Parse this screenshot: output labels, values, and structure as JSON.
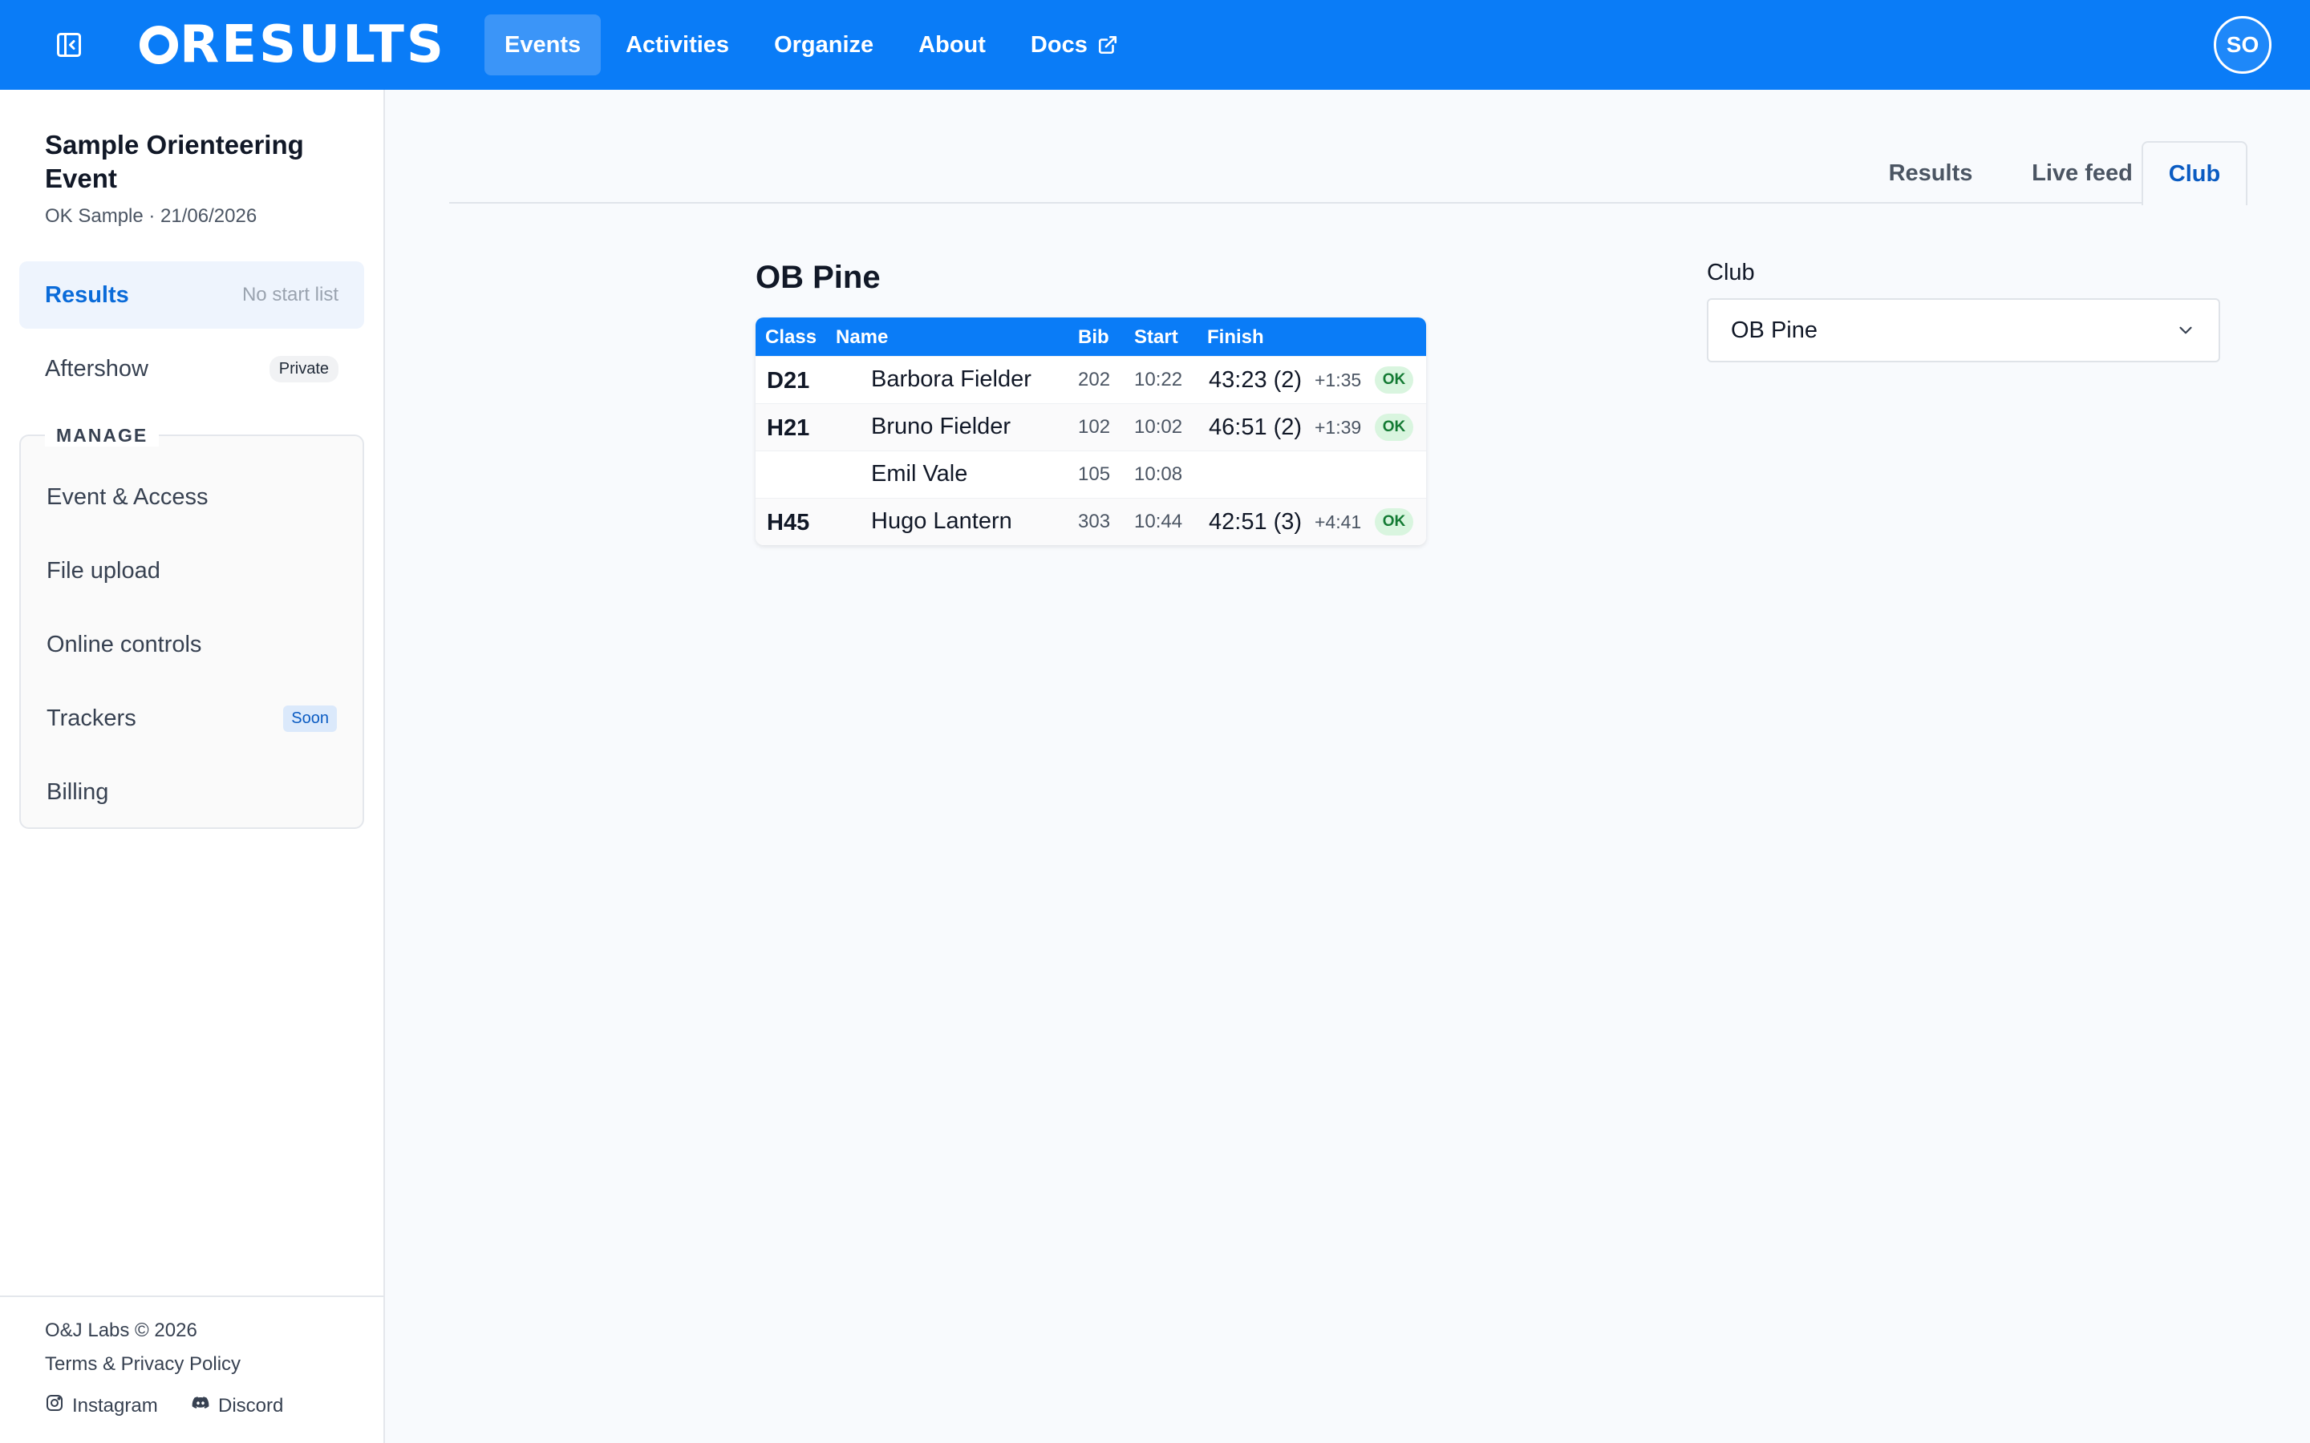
{
  "brand": {
    "logo_text": "RESULTS"
  },
  "nav": {
    "items": [
      {
        "label": "Events",
        "active": true
      },
      {
        "label": "Activities"
      },
      {
        "label": "Organize"
      },
      {
        "label": "About"
      },
      {
        "label": "Docs",
        "external": true
      }
    ]
  },
  "user": {
    "initials": "SO"
  },
  "event": {
    "title": "Sample Orienteering Event",
    "meta": "OK Sample · 21/06/2026"
  },
  "sidebar": {
    "results": {
      "label": "Results",
      "note": "No start list"
    },
    "aftershow": {
      "label": "Aftershow",
      "badge": "Private"
    },
    "manage": {
      "title": "MANAGE",
      "items": [
        {
          "label": "Event & Access"
        },
        {
          "label": "File upload"
        },
        {
          "label": "Online controls"
        },
        {
          "label": "Trackers",
          "badge": "Soon"
        },
        {
          "label": "Billing"
        }
      ]
    },
    "footer": {
      "copyright": "O&J Labs © 2026",
      "terms": "Terms & Privacy Policy",
      "instagram": "Instagram",
      "discord": "Discord"
    }
  },
  "tabs": [
    {
      "label": "Results"
    },
    {
      "label": "Live feed"
    },
    {
      "label": "Club",
      "active": true
    }
  ],
  "club_view": {
    "heading": "OB Pine",
    "columns": {
      "class": "Class",
      "name": "Name",
      "bib": "Bib",
      "start": "Start",
      "finish": "Finish"
    },
    "rows": [
      {
        "class": "D21",
        "name": "Barbora Fielder",
        "bib": "202",
        "start": "10:22",
        "time": "43:23 (2)",
        "behind": "+1:35",
        "status": "OK"
      },
      {
        "class": "H21",
        "name": "Bruno Fielder",
        "bib": "102",
        "start": "10:02",
        "time": "46:51 (2)",
        "behind": "+1:39",
        "status": "OK"
      },
      {
        "class": "",
        "name": "Emil Vale",
        "bib": "105",
        "start": "10:08",
        "time": "",
        "behind": "",
        "status": ""
      },
      {
        "class": "H45",
        "name": "Hugo Lantern",
        "bib": "303",
        "start": "10:44",
        "time": "42:51 (3)",
        "behind": "+4:41",
        "status": "OK"
      }
    ]
  },
  "club_filter": {
    "label": "Club",
    "selected": "OB Pine"
  },
  "colors": {
    "brand_blue": "#0a7cf7",
    "active_nav": "#3b95f8",
    "ok_bg": "#d9f5df",
    "ok_text": "#137a33"
  },
  "icons": {
    "sidebar_toggle": "sidebar-collapse-icon",
    "docs_external": "external-link-icon",
    "select": "chevron-down-icon",
    "instagram": "instagram-icon",
    "discord": "discord-icon"
  }
}
